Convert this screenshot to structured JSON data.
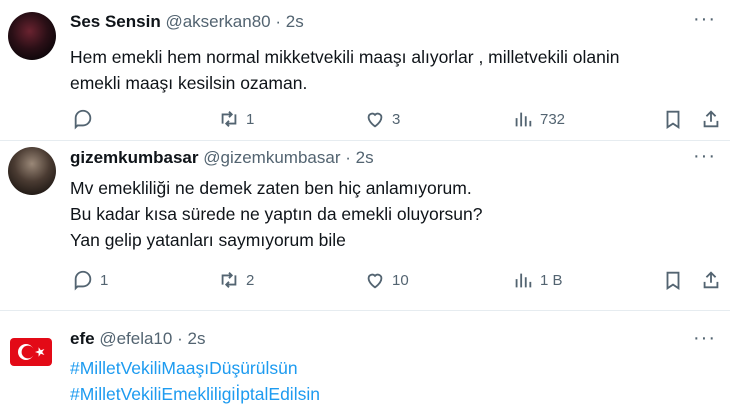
{
  "tweets": [
    {
      "name": "Ses Sensin",
      "handle": "@akserkan80",
      "separator": "·",
      "time": "2s",
      "lines": [
        "Hem emekli hem normal mikketvekili maaşı alıyorlar , milletvekili olanin",
        "emekli maaşı kesilsin ozaman."
      ],
      "replies": "",
      "reposts": "1",
      "likes": "3",
      "views": "732"
    },
    {
      "name": "gizemkumbasar",
      "handle": "@gizemkumbasar",
      "separator": "·",
      "time": "2s",
      "lines": [
        "Mv emekliliği ne demek zaten ben hiç anlamıyorum.",
        "Bu kadar kısa sürede ne yaptın da emekli oluyorsun?",
        "Yan gelip yatanları saymıyorum bile"
      ],
      "replies": "1",
      "reposts": "2",
      "likes": "10",
      "views": "1 B"
    },
    {
      "name": "efe",
      "handle": "@efela10",
      "separator": "·",
      "time": "2s",
      "hashtags": [
        "#MilletVekiliMaaşıDüşürülsün",
        "#MilletVekiliEmekliligiİptalEdilsin"
      ]
    }
  ],
  "more_glyph": "···",
  "colors": {
    "link": "#1d9bf0",
    "muted": "#536471",
    "flag_red": "#e30a17"
  }
}
